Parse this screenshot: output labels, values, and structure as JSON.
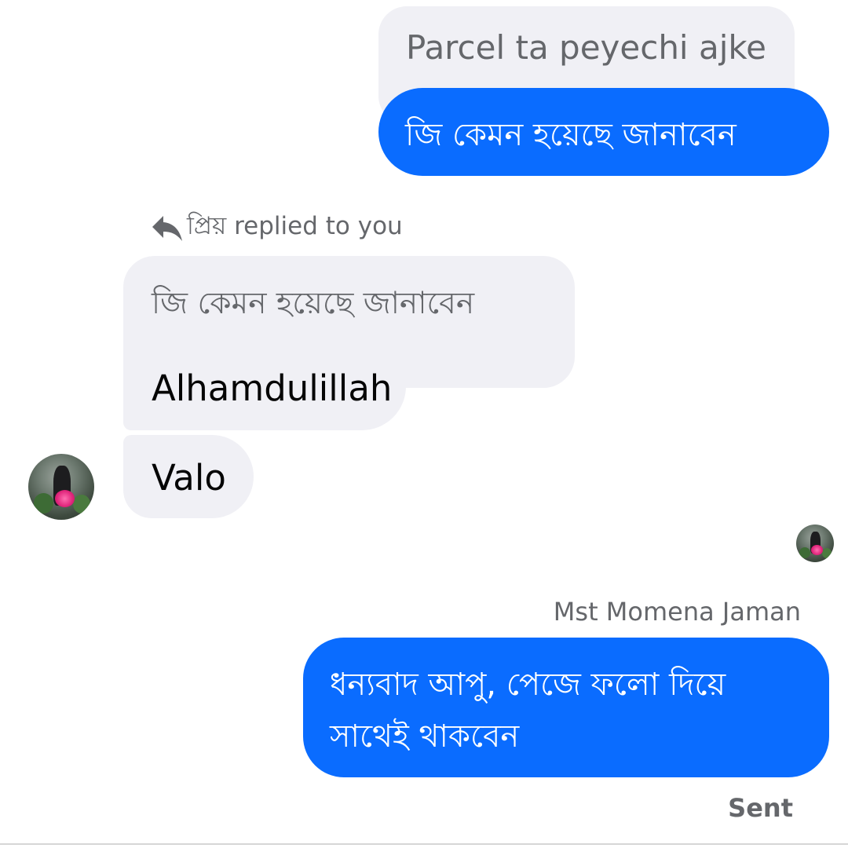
{
  "messages": {
    "quoted_sent": "Parcel ta peyechi ajke",
    "sent_1": "জি কেমন হয়েছে জানাবেন",
    "reply_header": "প্রিয় replied to you",
    "quoted_reply": "জি কেমন হয়েছে জানাবেন",
    "received_1": "Alhamdulillah",
    "received_2": "Valo",
    "sender_name": "Mst Momena Jaman",
    "sent_2_line1": "ধন্যবাদ আপু, পেজে ফলো দিয়ে",
    "sent_2_line2": "সাথেই থাকবেন",
    "status": "Sent"
  },
  "icons": {
    "reply": "reply-arrow-icon"
  },
  "colors": {
    "outgoing_bubble": "#0a6cff",
    "incoming_bubble": "#f0f0f5",
    "secondary_text": "#65676b"
  }
}
